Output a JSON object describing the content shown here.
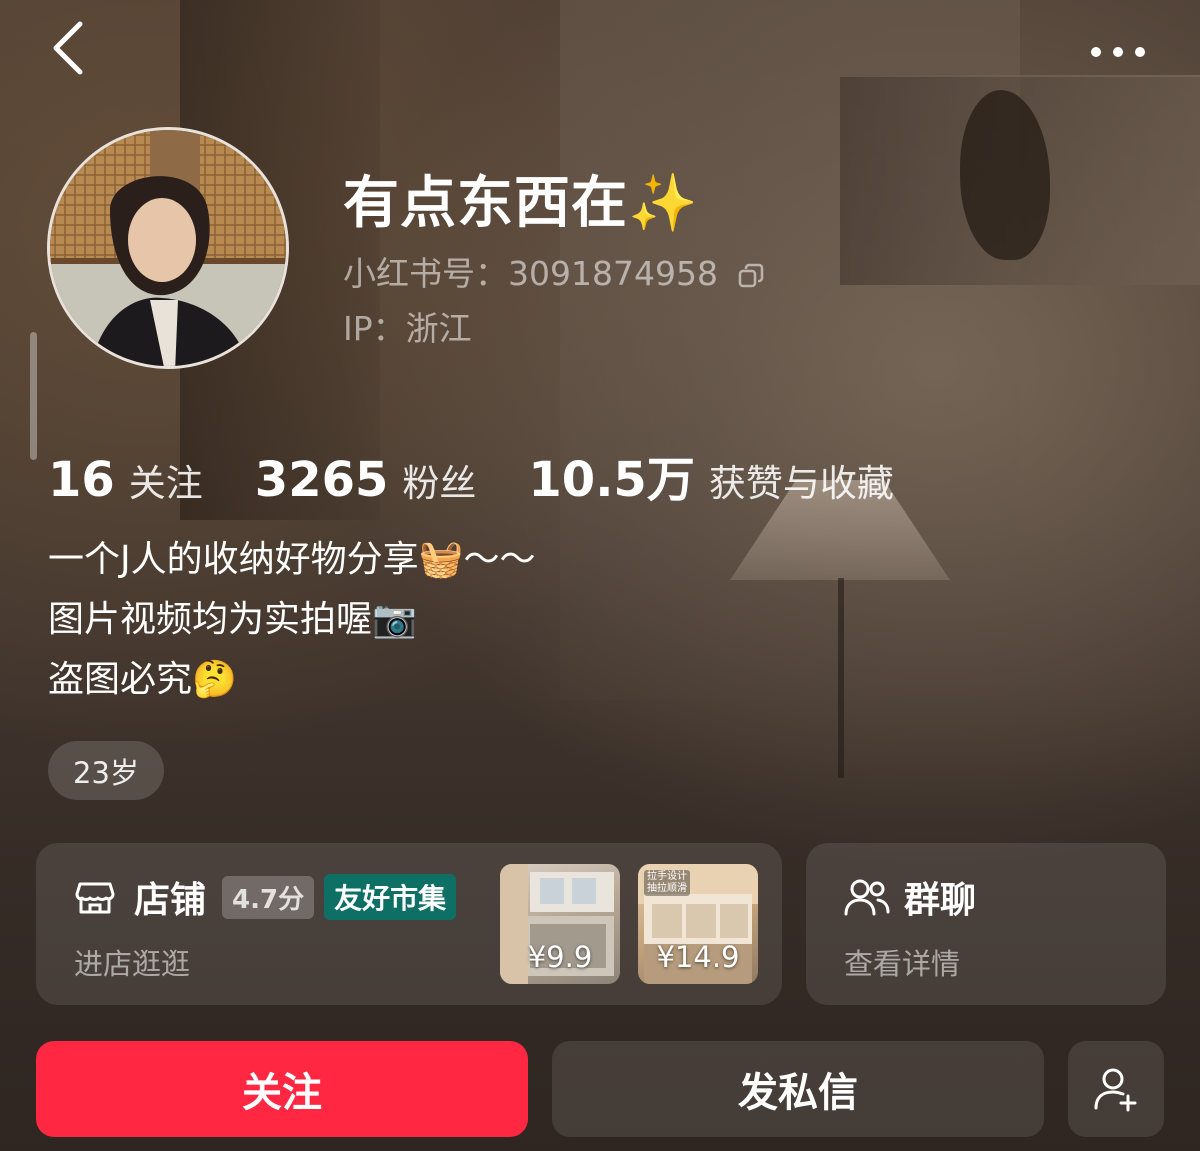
{
  "profile": {
    "name": "有点东西在",
    "name_emoji": "✨",
    "id_text": "小红书号：3091874958",
    "ip_text": "IP：浙江"
  },
  "stats": [
    {
      "value": "16",
      "label": "关注"
    },
    {
      "value": "3265",
      "label": "粉丝"
    },
    {
      "value": "10.5万",
      "label": "获赞与收藏"
    }
  ],
  "bio": {
    "line1": "一个J人的收纳好物分享🧺～～",
    "line2": "图片视频均为实拍喔📷",
    "line3": "盗图必究🤔"
  },
  "tags": {
    "age": "23岁"
  },
  "shop": {
    "title": "店铺",
    "rating": "4.7分",
    "market_badge": "友好市集",
    "subtitle": "进店逛逛",
    "products": [
      {
        "price": "¥9.9",
        "tag": ""
      },
      {
        "price": "¥14.9",
        "tag": "拉手设计\n抽拉顺滑"
      }
    ]
  },
  "group": {
    "title": "群聊",
    "subtitle": "查看详情"
  },
  "actions": {
    "follow": "关注",
    "message": "发私信"
  },
  "colors": {
    "follow_button": "#ff2742",
    "market_badge": "#0e6f64",
    "background": "#3b2f28"
  },
  "icons": {
    "back": "chevron-left-icon",
    "more": "more-dots-icon",
    "copy": "copy-icon",
    "shop": "shop-icon",
    "group": "group-chat-icon",
    "add_friend": "add-user-icon"
  }
}
